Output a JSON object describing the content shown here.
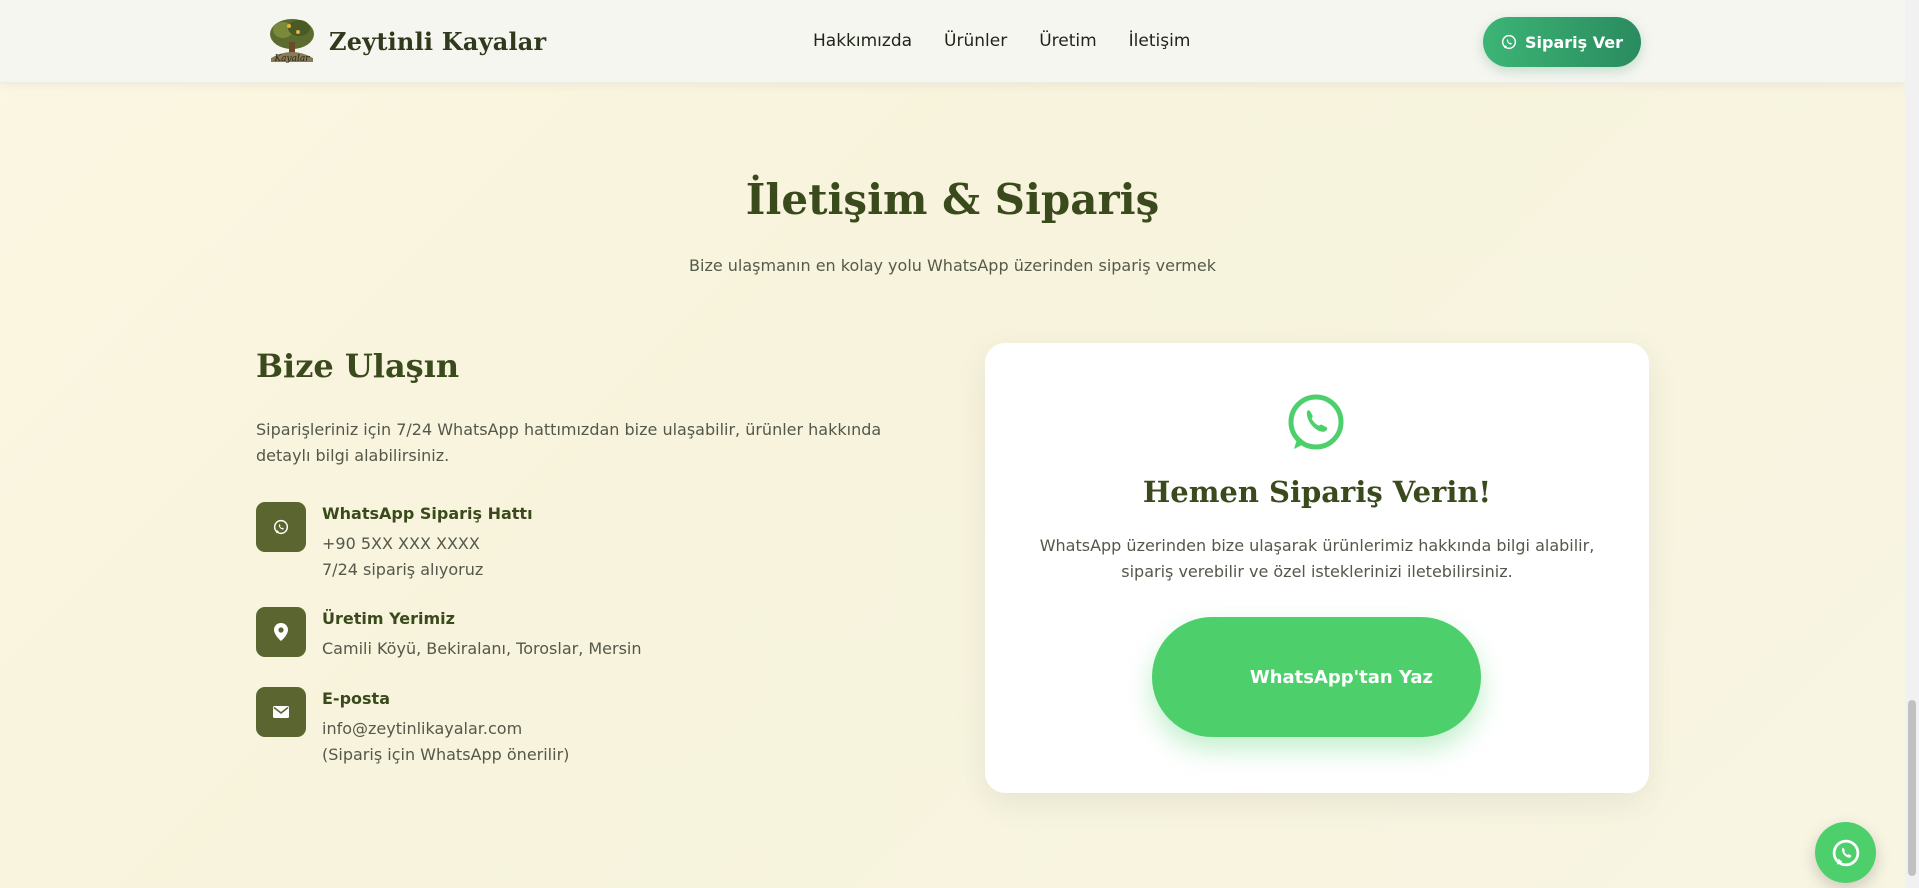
{
  "header": {
    "brand": "Zeytinli Kayalar",
    "nav": [
      "Hakkımızda",
      "Ürünler",
      "Üretim",
      "İletişim"
    ],
    "order_button": "Sipariş Ver"
  },
  "section": {
    "title": "İletişim & Sipariş",
    "subtitle": "Bize ulaşmanın en kolay yolu WhatsApp üzerinden sipariş vermek"
  },
  "contact": {
    "title": "Bize Ulaşın",
    "description": "Siparişleriniz için 7/24 WhatsApp hattımızdan bize ulaşabilir, ürünler hakkında detaylı bilgi alabilirsiniz.",
    "items": [
      {
        "icon": "whatsapp-icon",
        "title": "WhatsApp Sipariş Hattı",
        "lines": [
          "+90 5XX XXX XXXX",
          "7/24 sipariş alıyoruz"
        ]
      },
      {
        "icon": "location-pin-icon",
        "title": "Üretim Yerimiz",
        "lines": [
          "Camili Köyü, Bekiralanı, Toroslar, Mersin"
        ]
      },
      {
        "icon": "envelope-icon",
        "title": "E-posta",
        "lines": [
          "info@zeytinlikayalar.com",
          "(Sipariş için WhatsApp önerilir)"
        ]
      }
    ]
  },
  "card": {
    "title": "Hemen Sipariş Verin!",
    "text": "WhatsApp üzerinden bize ulaşarak ürünlerimiz hakkında bilgi alabilir, sipariş verebilir ve özel isteklerinizi iletebilirsiniz.",
    "button": "WhatsApp'tan Yaz"
  },
  "colors": {
    "accent_green": "#4dd06c",
    "olive": "#5a6530",
    "heading": "#3a4a1c",
    "background": "#f8f5e3"
  }
}
